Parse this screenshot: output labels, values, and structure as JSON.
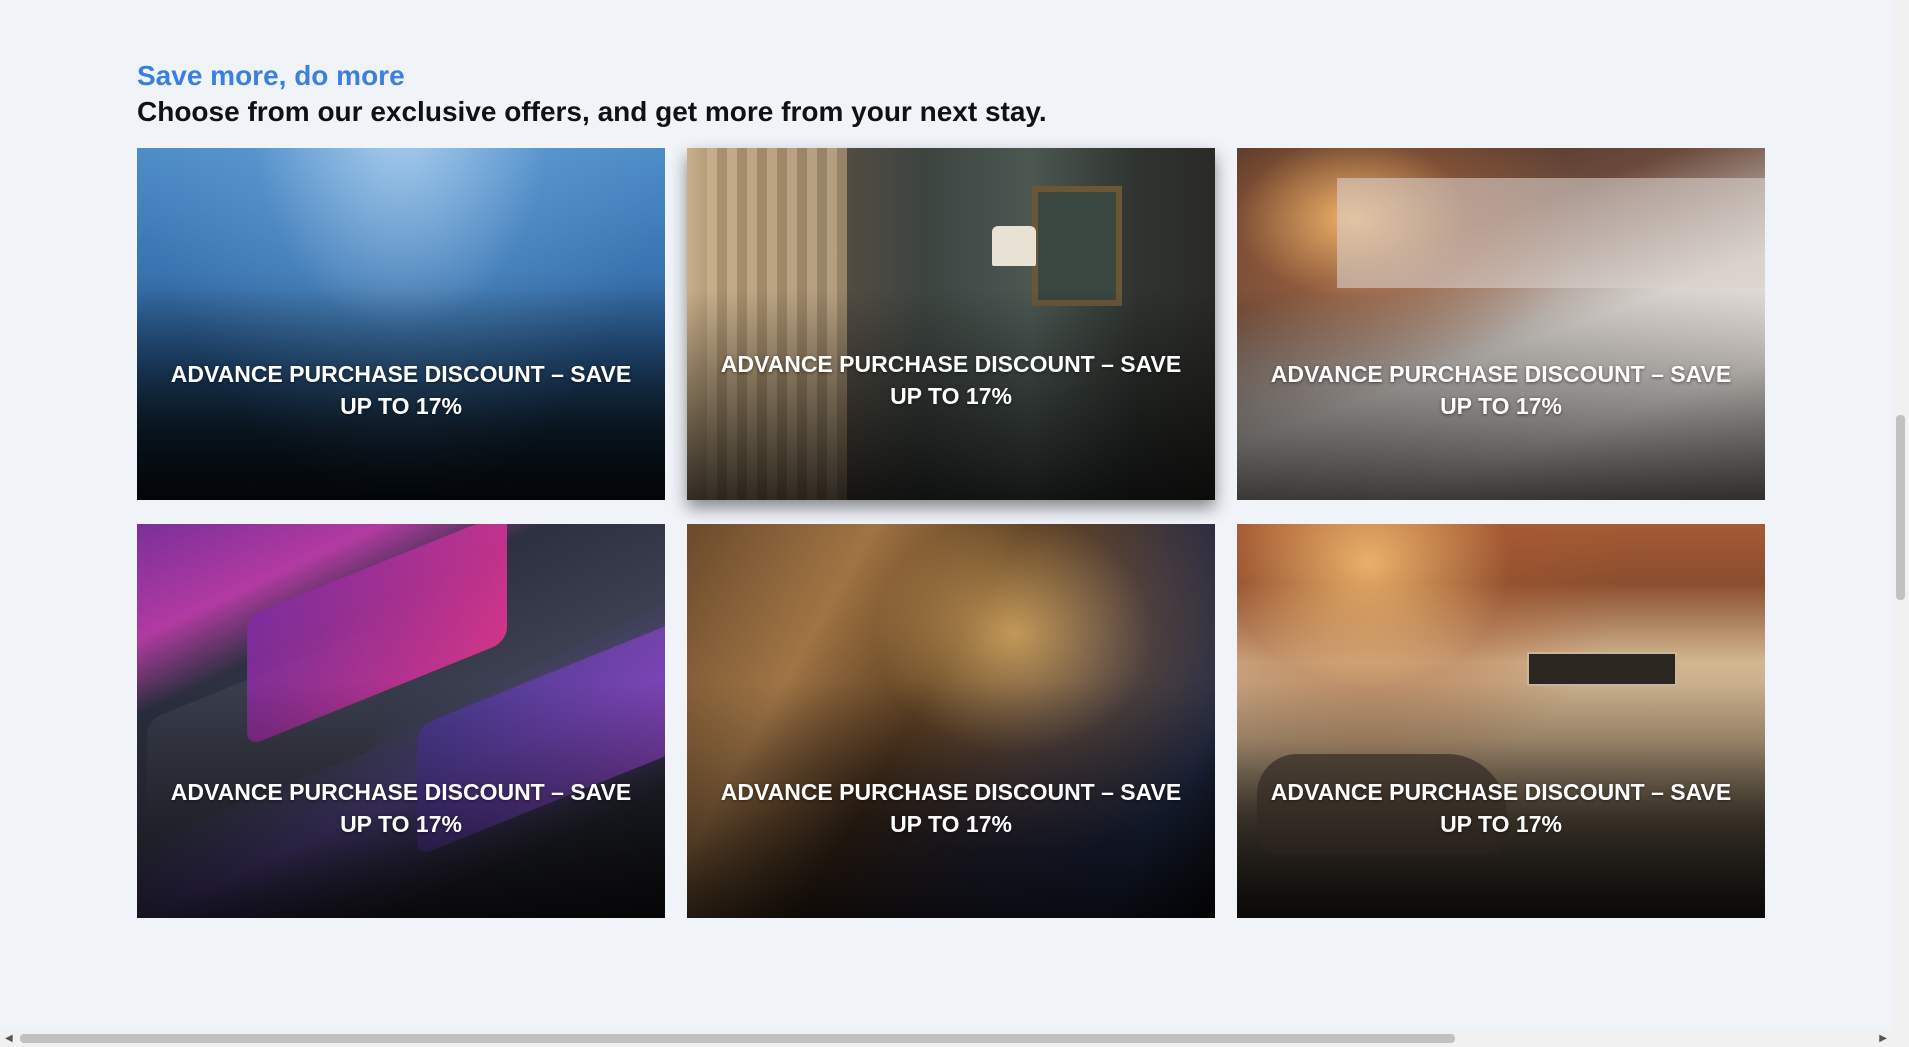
{
  "section": {
    "eyebrow": "Save more, do more",
    "headline": "Choose from our exclusive offers, and get more from your next stay."
  },
  "offers": [
    {
      "title": "ADVANCE PURCHASE DISCOUNT – SAVE UP TO 17%",
      "image": "underwater-image"
    },
    {
      "title": "ADVANCE PURCHASE DISCOUNT – SAVE UP TO 17%",
      "image": "hotel-room-couple-image"
    },
    {
      "title": "ADVANCE PURCHASE DISCOUNT – SAVE UP TO 17%",
      "image": "couple-in-bed-image"
    },
    {
      "title": "ADVANCE PURCHASE DISCOUNT – SAVE UP TO 17%",
      "image": "credit-cards-image"
    },
    {
      "title": "ADVANCE PURCHASE DISCOUNT – SAVE UP TO 17%",
      "image": "front-desk-image"
    },
    {
      "title": "ADVANCE PURCHASE DISCOUNT – SAVE UP TO 17%",
      "image": "hotel-entrance-image"
    }
  ],
  "colors": {
    "accent": "#3b7fe0",
    "background": "#f0f4f9"
  }
}
